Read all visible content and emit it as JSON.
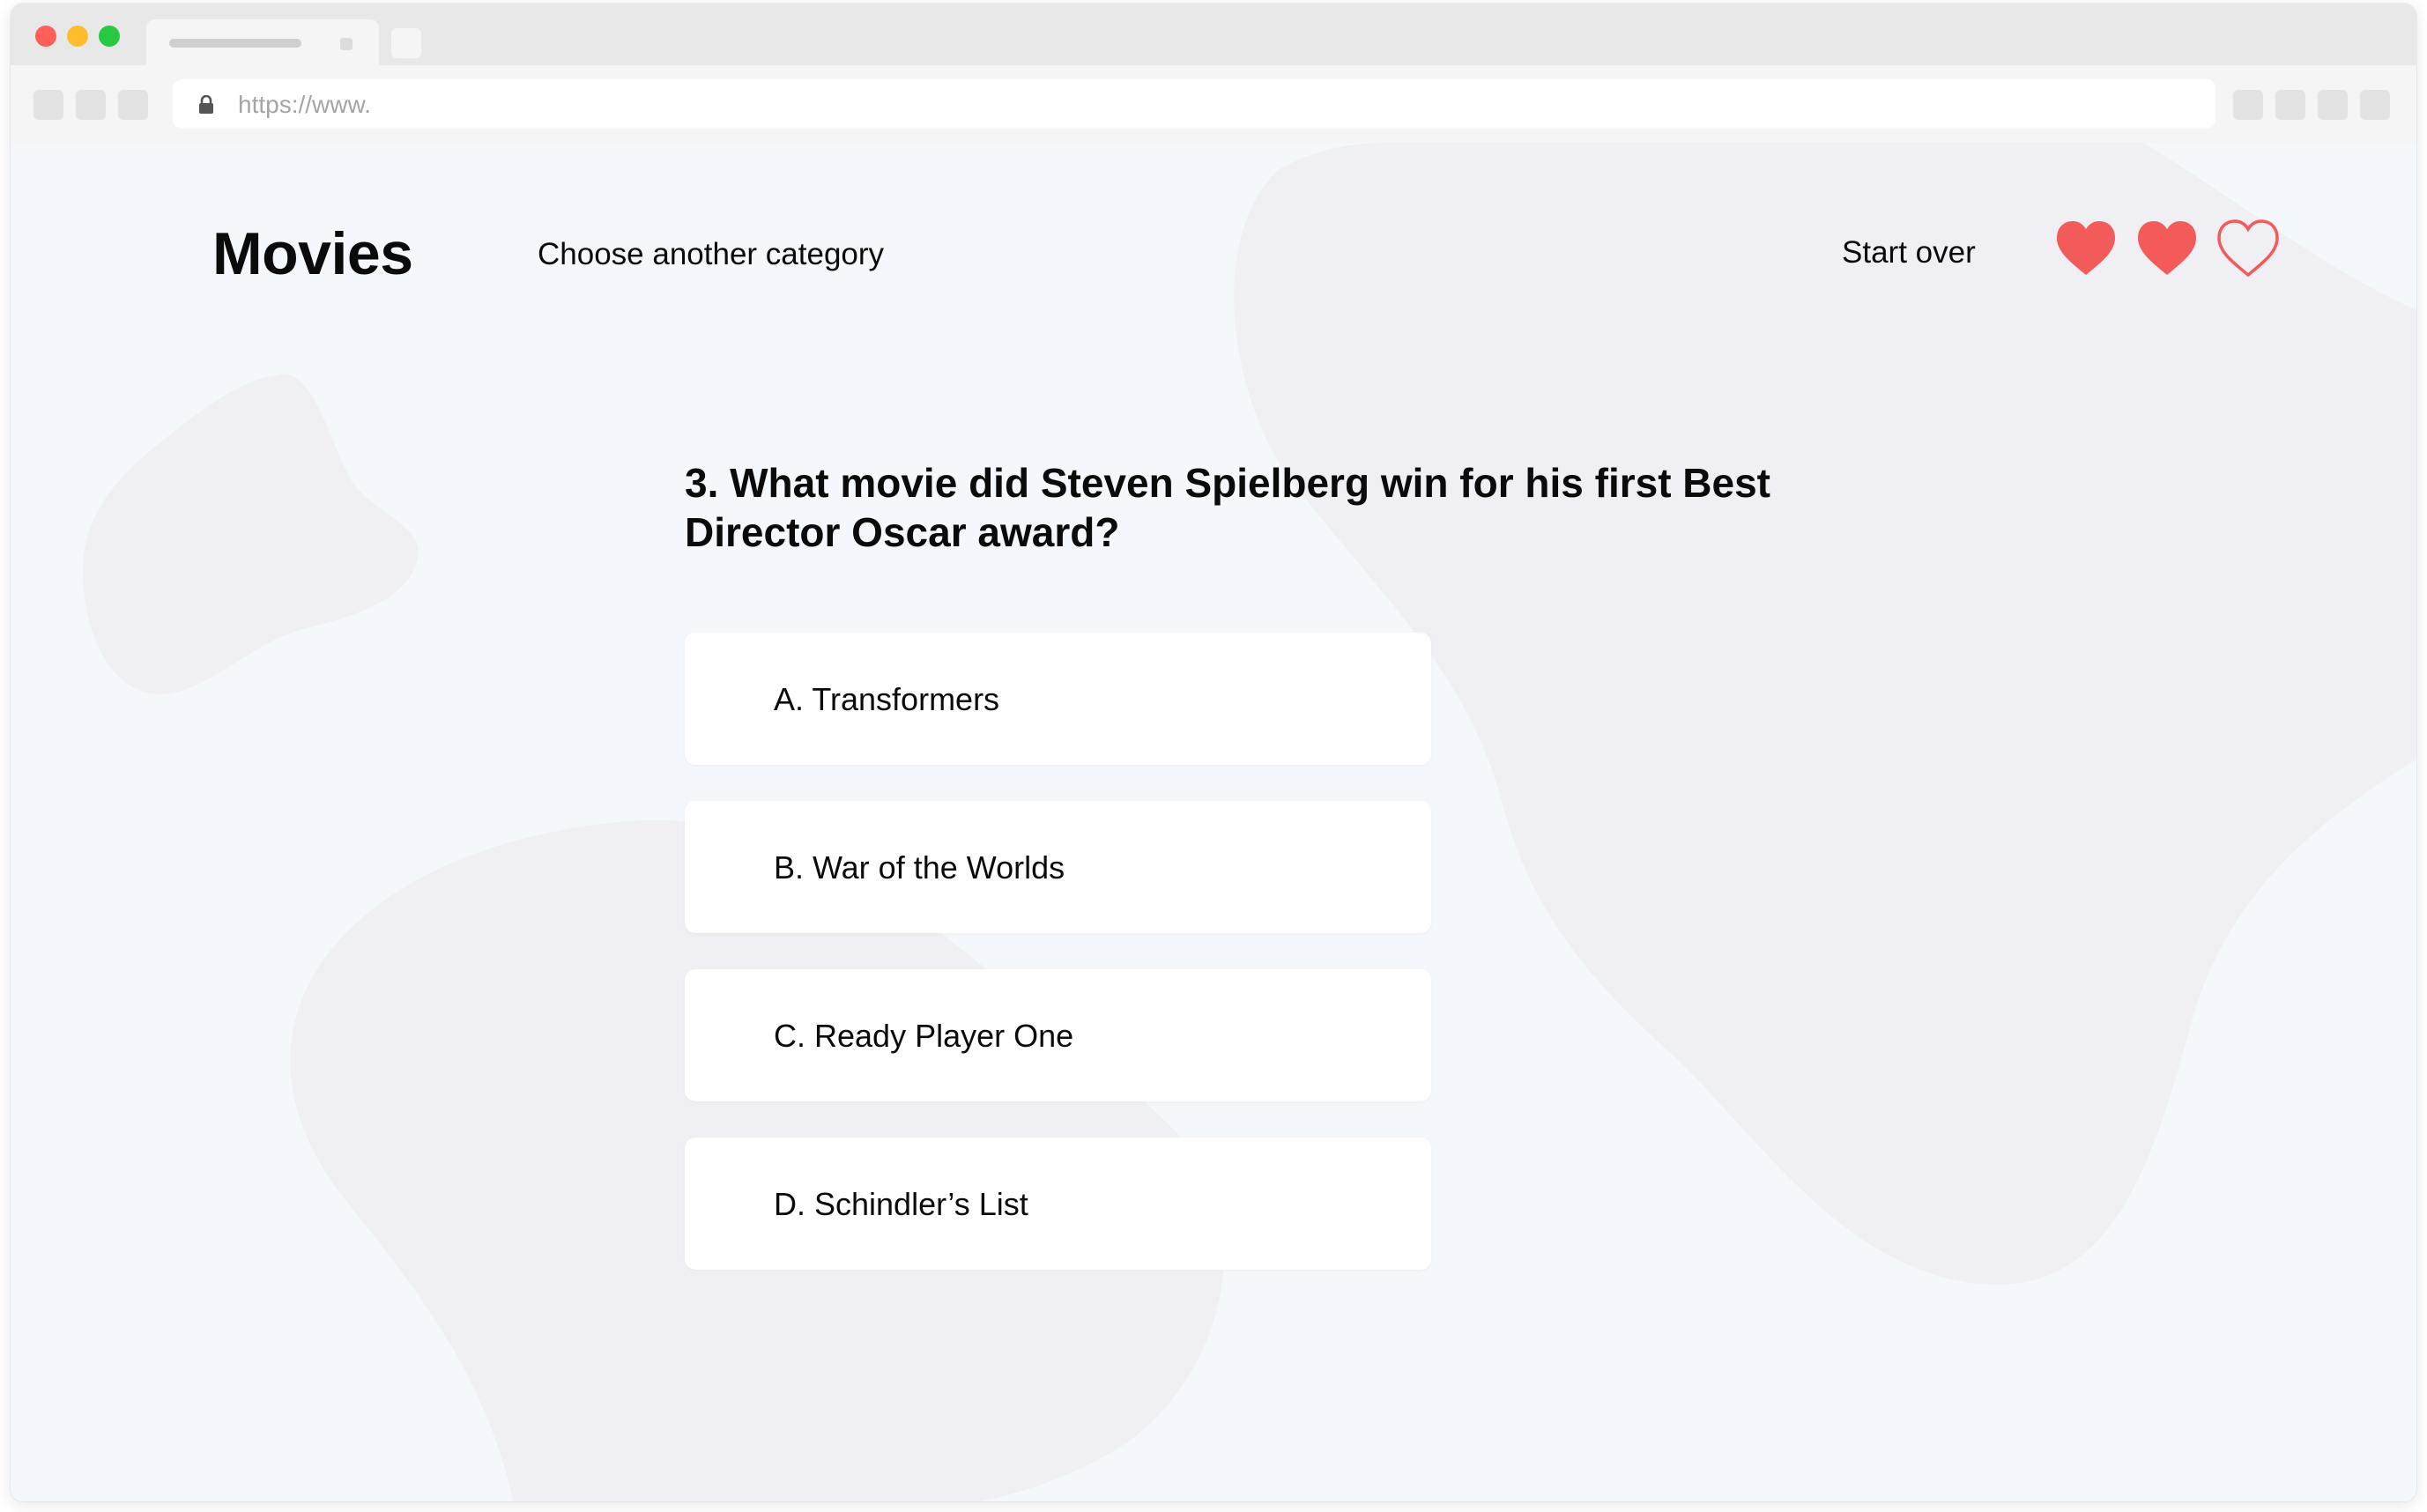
{
  "browser": {
    "url": "https://www.",
    "icons": {
      "lock": "lock-icon"
    }
  },
  "header": {
    "brand": "Movies",
    "nav_link": "Choose another category",
    "start_over": "Start over",
    "lives": {
      "total": 3,
      "remaining": 2,
      "color": "#f35a5a"
    }
  },
  "quiz": {
    "question": "3. What movie did Steven Spielberg win for his first Best Director Oscar award?",
    "answers": [
      {
        "label": "A. Transformers"
      },
      {
        "label": "B. War of the Worlds"
      },
      {
        "label": "C. Ready Player One"
      },
      {
        "label": "D. Schindler’s List"
      }
    ]
  },
  "colors": {
    "page_background": "#f4f8fc",
    "blob": "#f0f0f4",
    "heart": "#f35a5a"
  }
}
